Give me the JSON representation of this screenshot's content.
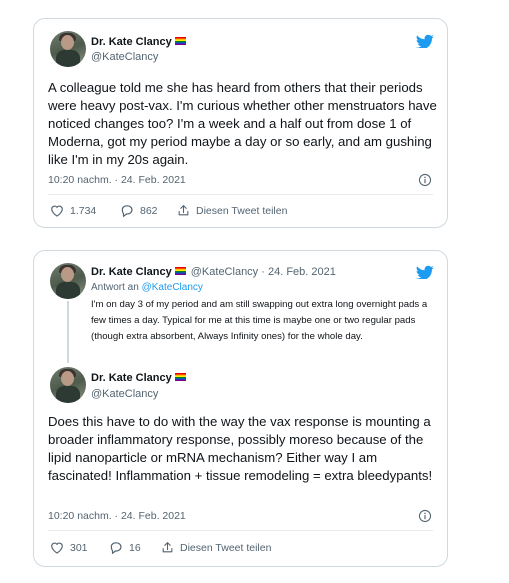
{
  "tweet1": {
    "author_name": "Dr. Kate Clancy",
    "author_handle": "@KateClancy",
    "text": "A colleague told me she has heard from others that their periods were heavy post-vax. I'm curious whether other menstruators have noticed changes too? I'm a week and a half out from dose 1 of Moderna, got my period maybe a day or so early, and am gushing like I'm in my 20s again.",
    "timestamp": "10:20 nachm. · 24. Feb. 2021",
    "likes": "1.734",
    "replies": "862",
    "share_label": "Diesen Tweet teilen"
  },
  "tweet2": {
    "parent": {
      "author_name": "Dr. Kate Clancy",
      "author_handle": "@KateClancy",
      "date": "· 24. Feb. 2021",
      "reply_prefix": "Antwort an",
      "reply_handle": "@KateClancy",
      "text": "I'm on day 3 of my period and am still swapping out extra long overnight pads a few times a day. Typical for me at this time is maybe one or two regular pads (though extra absorbent, Always Infinity ones) for the whole day."
    },
    "author_name": "Dr. Kate Clancy",
    "author_handle": "@KateClancy",
    "text": "Does this have to do with the way the vax response is mounting a broader inflammatory response, possibly moreso because of the lipid nanoparticle or mRNA mechanism? Either way I am fascinated! Inflammation + tissue remodeling = extra bleedypants!",
    "timestamp": "10:20 nachm. · 24. Feb. 2021",
    "likes": "301",
    "replies": "16",
    "share_label": "Diesen Tweet teilen"
  },
  "colors": {
    "twitter_blue": "#1d9bf0",
    "secondary_text": "#536471",
    "border": "#cfd9de"
  },
  "icons": [
    "twitter-bird-icon",
    "info-icon",
    "heart-icon",
    "reply-icon",
    "share-icon",
    "rainbow-flag-icon"
  ]
}
